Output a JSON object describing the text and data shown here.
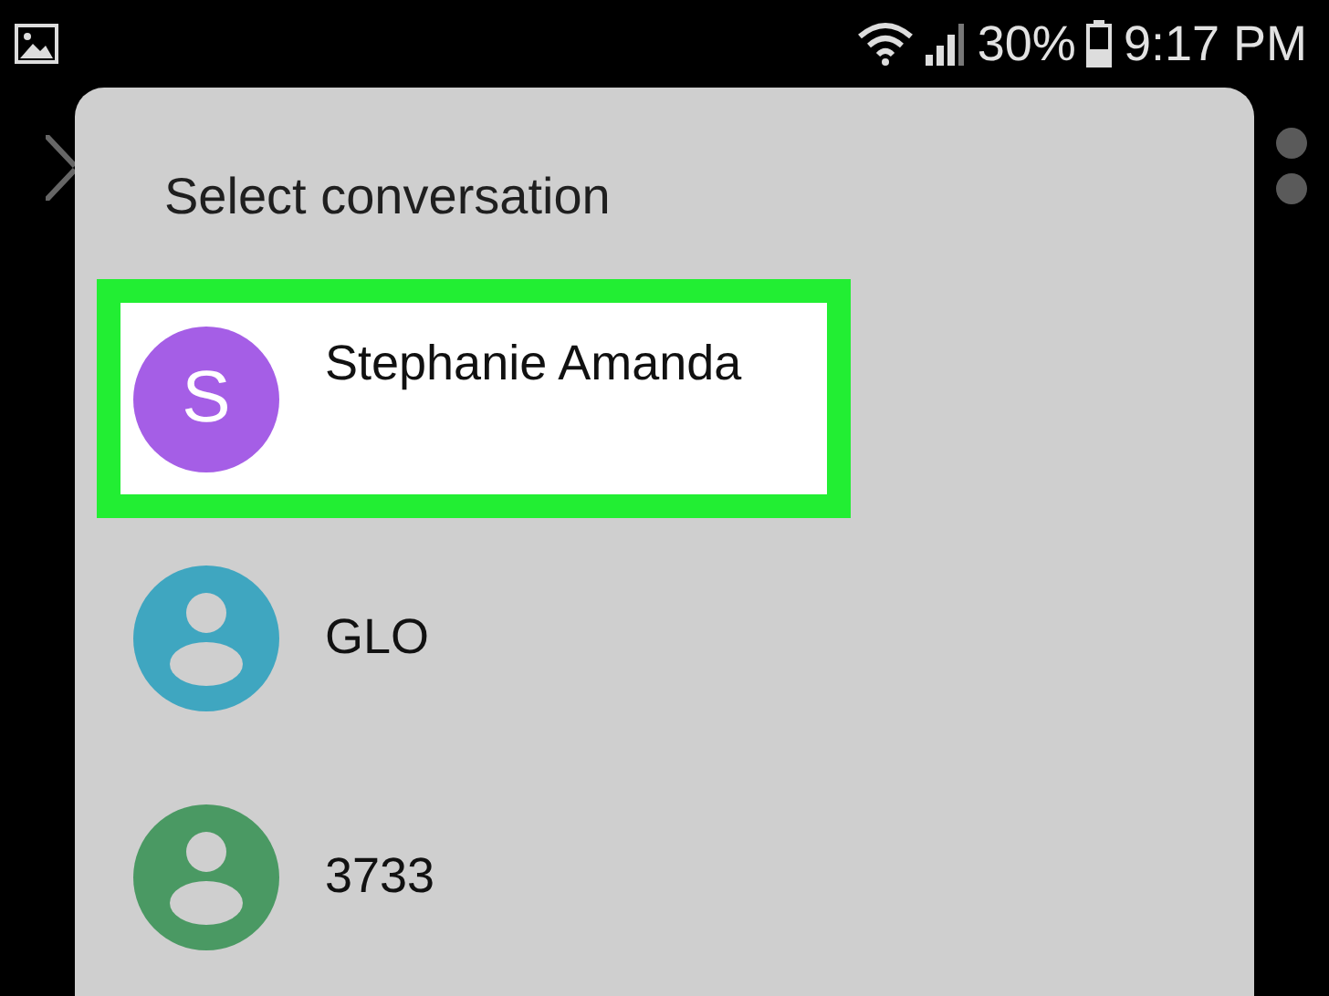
{
  "status_bar": {
    "battery_percent": "30%",
    "time": "9:17 PM"
  },
  "dialog": {
    "title": "Select conversation",
    "conversations": [
      {
        "name": "Stephanie Amanda",
        "selected": true,
        "avatar": {
          "kind": "letter",
          "initial": "S",
          "color": "#a55ee6"
        }
      },
      {
        "name": "GLO",
        "selected": false,
        "avatar": {
          "kind": "person",
          "color": "#3fa6c0"
        }
      },
      {
        "name": "3733",
        "selected": false,
        "avatar": {
          "kind": "person",
          "color": "#4a9963"
        }
      }
    ]
  }
}
